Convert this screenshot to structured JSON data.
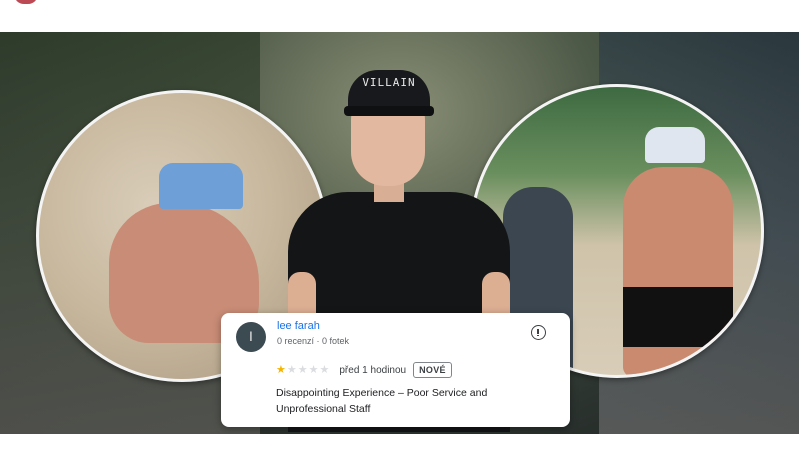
{
  "review": {
    "avatar_letter": "l",
    "reviewer_name": "lee farah",
    "reviewer_stats": "0 recenzí · 0 fotek",
    "rating": 1,
    "rating_max": 5,
    "time_ago": "před 1 hodinou",
    "badge": "NOVÉ",
    "title": "Disappointing Experience – Poor Service and Unprofessional Staff"
  },
  "hero": {
    "cap_text": "VILLAIN"
  },
  "colors": {
    "link_blue": "#1a73e8",
    "star_gold": "#f5b400",
    "star_empty": "#dadce0",
    "avatar_bg": "#3c4a52"
  },
  "icons": [
    "info-icon",
    "star-icon"
  ]
}
